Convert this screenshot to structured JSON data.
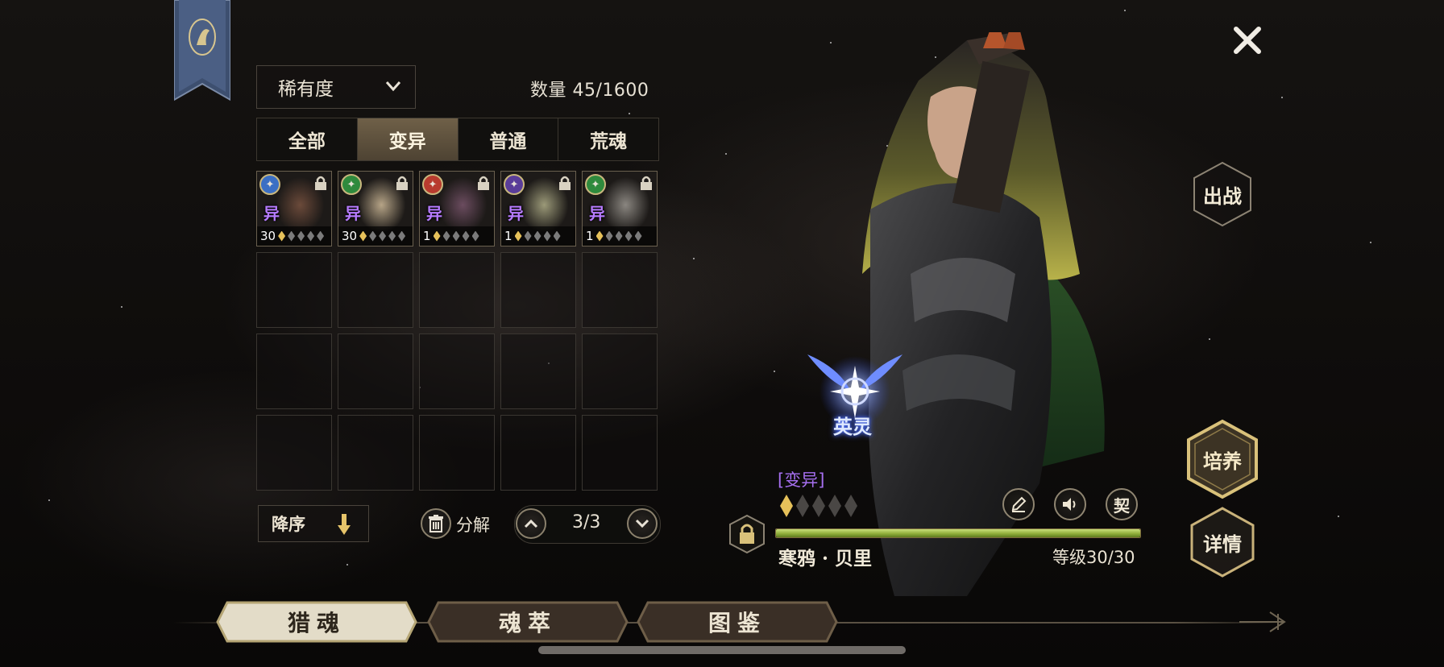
{
  "filter": {
    "sort_label": "稀有度",
    "count_label": "数量 45/1600"
  },
  "tabs": [
    {
      "label": "全部",
      "active": false
    },
    {
      "label": "变异",
      "active": true
    },
    {
      "label": "普通",
      "active": false
    },
    {
      "label": "荒魂",
      "active": false
    }
  ],
  "cards": [
    {
      "level": "30",
      "variant_mark": "异",
      "stars_on": 1,
      "stars_total": 5,
      "element_icon": "wave-icon",
      "element_color": "#3b6fc4"
    },
    {
      "level": "30",
      "variant_mark": "异",
      "stars_on": 1,
      "stars_total": 5,
      "element_icon": "leaf-icon",
      "element_color": "#2f8a3d"
    },
    {
      "level": "1",
      "variant_mark": "异",
      "stars_on": 1,
      "stars_total": 5,
      "element_icon": "flame-icon",
      "element_color": "#b83b2e"
    },
    {
      "level": "1",
      "variant_mark": "异",
      "stars_on": 1,
      "stars_total": 5,
      "element_icon": "moon-icon",
      "element_color": "#5a3d99"
    },
    {
      "level": "1",
      "variant_mark": "异",
      "stars_on": 1,
      "stars_total": 5,
      "element_icon": "leaf-icon",
      "element_color": "#2f8a3d"
    }
  ],
  "bottom_controls": {
    "order_label": "降序",
    "decompose_label": "分解",
    "page": "3/3"
  },
  "hero": {
    "emblem_label": "英灵",
    "rarity_tag": "[变异]",
    "stars_on": 1,
    "stars_total": 5,
    "name": "寒鸦 · 贝里",
    "level_text": "等级30/30",
    "exp_fraction": 1.0,
    "contract_label": "契"
  },
  "side_buttons": {
    "deploy": "出战",
    "train": "培养",
    "details": "详情"
  },
  "bottom_nav": [
    {
      "label": "猎魂",
      "active": true
    },
    {
      "label": "魂萃",
      "active": false
    },
    {
      "label": "图鉴",
      "active": false
    }
  ],
  "colors": {
    "accent_gold": "#d9c17a",
    "variant_purple": "#a66ff0",
    "exp_green": "#a8c64f"
  }
}
